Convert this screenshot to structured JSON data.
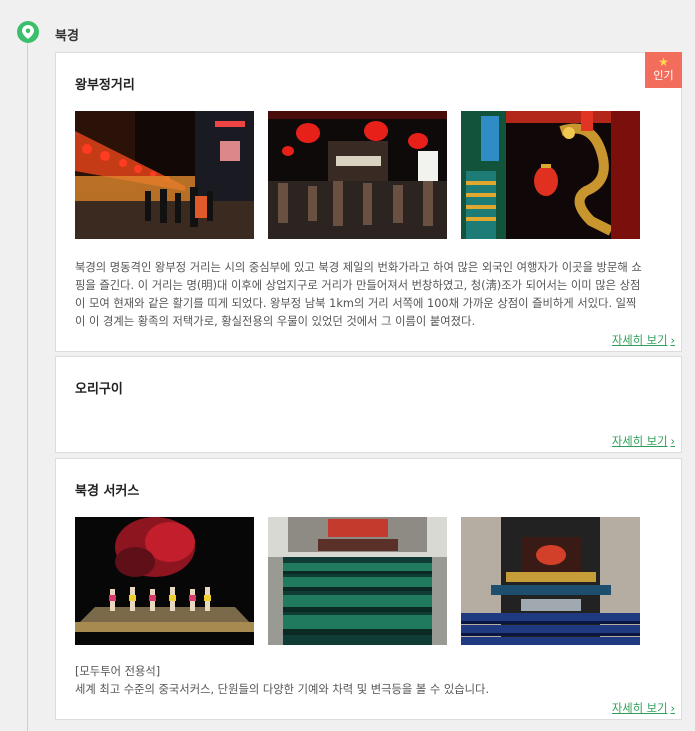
{
  "city": {
    "title": "북경"
  },
  "colors": {
    "accent": "#3cbf6c",
    "badge": "#f26d5b",
    "link": "#2e9f5a"
  },
  "cards": [
    {
      "title": "왕부정거리",
      "badge": {
        "icon": "star-icon",
        "label": "인기"
      },
      "photos": [
        "night-market-street-photo",
        "crowded-street-lanterns-photo",
        "dragon-lantern-decoration-photo"
      ],
      "description_lines": [
        "북경의 명동격인 왕부정 거리는 시의 중심부에 있고 북경 제일의 번화가라고 하여 많은 외국인 여행자가 이곳을 방문해 쇼",
        "핑을 즐긴다. 이 거리는 명(明)대 이후에 상업지구로 거리가 만들어져서 번창하였고, 청(淸)조가 되어서는 이미 많은 상점",
        "이 모여 현재와 같은 활기를 띠게 되었다. 왕부정 남북 1km의 거리 서쪽에 100채 가까운 상점이 즐비하게 서있다. 일찍",
        "이 이 경계는 황족의 저택가로, 황실전용의 우물이 있었던 것에서 그 이름이 붙여졌다."
      ],
      "more": "자세히 보기"
    },
    {
      "title": "오리구이",
      "more": "자세히 보기"
    },
    {
      "title": "북경 서커스",
      "photos": [
        "circus-stage-performers-photo",
        "theater-green-seats-photo",
        "theater-blue-seats-photo"
      ],
      "description_lines": [
        "[모두투어 전용석]",
        "세계 최고 수준의 중국서커스, 단원들의 다양한 기예와 차력 및 변극등을 볼 수 있습니다."
      ],
      "more": "자세히 보기"
    }
  ]
}
